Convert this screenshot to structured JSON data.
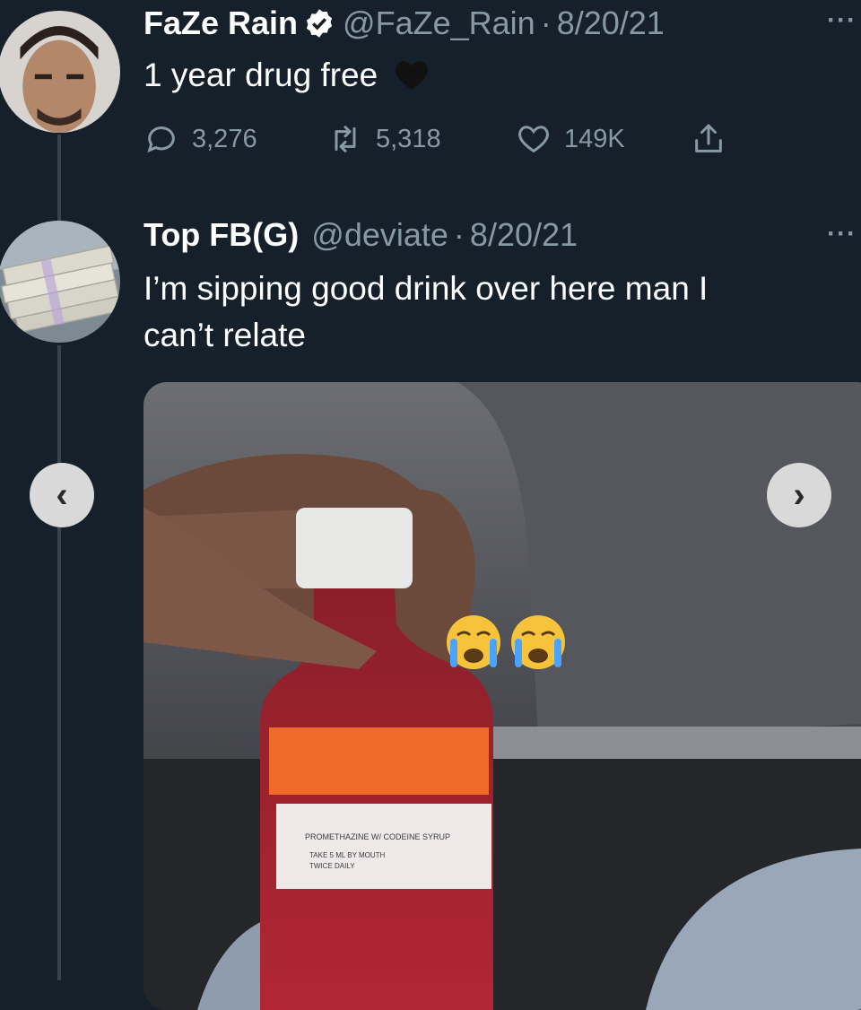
{
  "tweets": [
    {
      "name": "FaZe Rain",
      "handle": "@FaZe_Rain",
      "separator": "·",
      "date": "8/20/21",
      "text": "1 year drug free",
      "heart_emoji": "black-heart-emoji",
      "stats": {
        "replies": "3,276",
        "retweets": "5,318",
        "likes": "149K"
      },
      "more": "···"
    },
    {
      "name": "Top FB(G)",
      "handle": "@deviate",
      "separator": "·",
      "date": "8/20/21",
      "text_line1": "I’m sipping good drink over here man I",
      "text_line2": "can’t relate",
      "more": "···"
    }
  ],
  "media_nav": {
    "prev": "‹",
    "next": "›"
  },
  "media_label": {
    "line1": "PROMETHAZINE W/ CODEINE SYRUP",
    "line2": "TAKE 5 ML BY MOUTH",
    "line3": "TWICE DAILY"
  },
  "colors": {
    "background": "#15202b",
    "secondary_text": "#8899a6",
    "verified_badge": "#ffffff",
    "thread_line": "#38444d"
  }
}
